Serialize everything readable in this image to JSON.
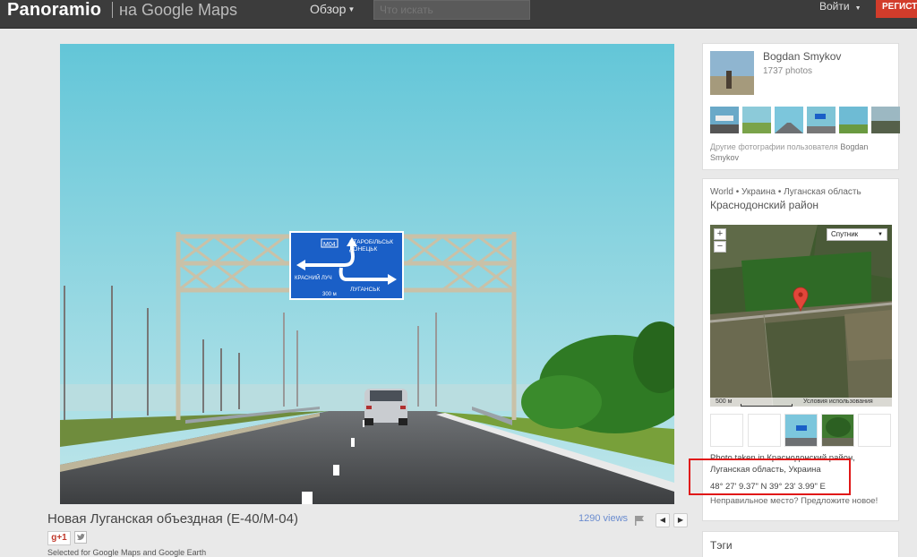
{
  "header": {
    "logo_text": "Panoramio",
    "logo_sub": "на Google Maps",
    "browse_label": "Обзор",
    "search_placeholder": "Что искать",
    "signin_label": "Войти",
    "register_label": "РЕГИСТР"
  },
  "photo": {
    "title": "Новая Луганская объездная (Е-40/М-04)",
    "views": "1290 views",
    "gplus_label": "g+1",
    "selected_note": "Selected for Google Maps and Google Earth",
    "sign": {
      "code": "М04",
      "top_text_1": "СТАРОБІЛЬСЬК",
      "top_text_2": "ДОНЕЦЬК",
      "left_text": "КРАСНИЙ ЛУЧ",
      "right_text": "ЛУГАНСЬК",
      "distance": "300 м"
    }
  },
  "user": {
    "name": "Bogdan Smykov",
    "photo_count": "1737 photos",
    "more_prefix": "Другие фотографии пользователя",
    "more_name": "Bogdan Smykov"
  },
  "location": {
    "breadcrumb": "World • Украина • Луганская область",
    "district": "Краснодонский район",
    "map_type": "Спутник",
    "zoom_in": "+",
    "zoom_out": "−",
    "scale_label": "500 м",
    "terms": "Условия использования",
    "photo_taken": "Photo taken in Краснодонский район, Луганская область, Украина",
    "coords": "48° 27' 9.37\" N  39° 23' 3.99\" E",
    "wrong_place": "Неправильное место? Предложите новое!"
  },
  "tags": {
    "title": "Тэги"
  },
  "colors": {
    "topbar": "#3c3c3c",
    "register": "#d23c2b",
    "sign_blue": "#1a5fc7",
    "highlight": "#e01818",
    "link": "#6a8ccf"
  }
}
